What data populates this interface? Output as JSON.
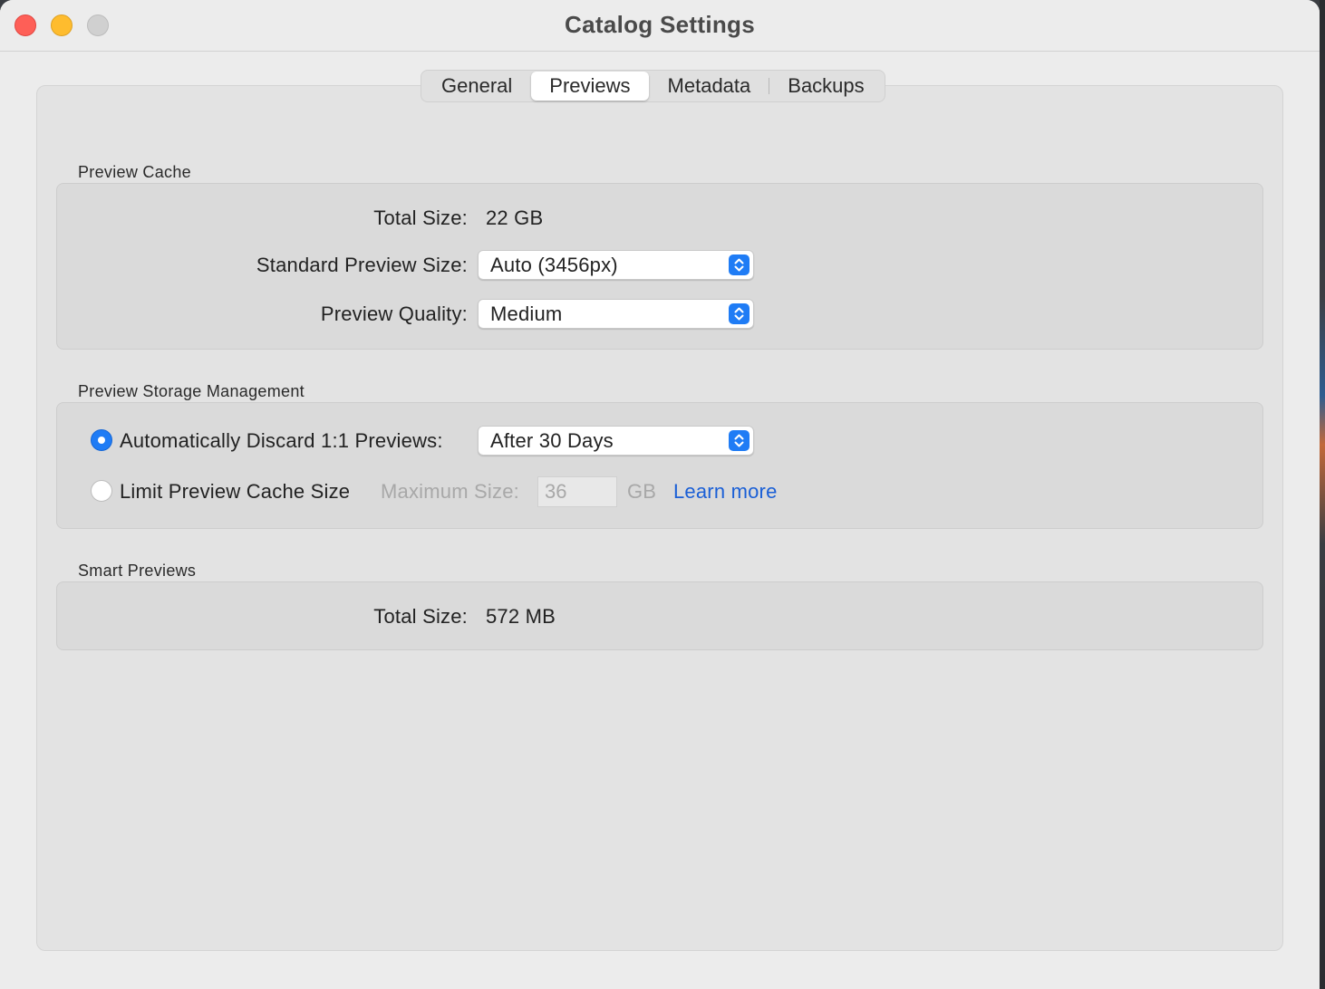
{
  "window": {
    "title": "Catalog Settings"
  },
  "tabs": [
    {
      "label": "General",
      "active": false
    },
    {
      "label": "Previews",
      "active": true
    },
    {
      "label": "Metadata",
      "active": false
    },
    {
      "label": "Backups",
      "active": false
    }
  ],
  "preview_cache": {
    "title": "Preview Cache",
    "total_size_label": "Total Size:",
    "total_size_value": "22 GB",
    "standard_preview_size_label": "Standard Preview Size:",
    "standard_preview_size_value": "Auto (3456px)",
    "preview_quality_label": "Preview Quality:",
    "preview_quality_value": "Medium"
  },
  "storage_management": {
    "title": "Preview Storage Management",
    "auto_discard_label": "Automatically Discard 1:1 Previews:",
    "auto_discard_selected": true,
    "auto_discard_value": "After 30 Days",
    "limit_cache_label": "Limit Preview Cache Size",
    "limit_cache_selected": false,
    "max_size_label": "Maximum Size:",
    "max_size_value": "36",
    "max_size_unit": "GB",
    "learn_more": "Learn more"
  },
  "smart_previews": {
    "title": "Smart Previews",
    "total_size_label": "Total Size:",
    "total_size_value": "572 MB"
  },
  "colors": {
    "accent": "#1f7cf5",
    "link": "#1a5fd6",
    "close": "#fe5f57",
    "minimize": "#febc2e",
    "zoom_disabled": "#d0d0d0"
  }
}
